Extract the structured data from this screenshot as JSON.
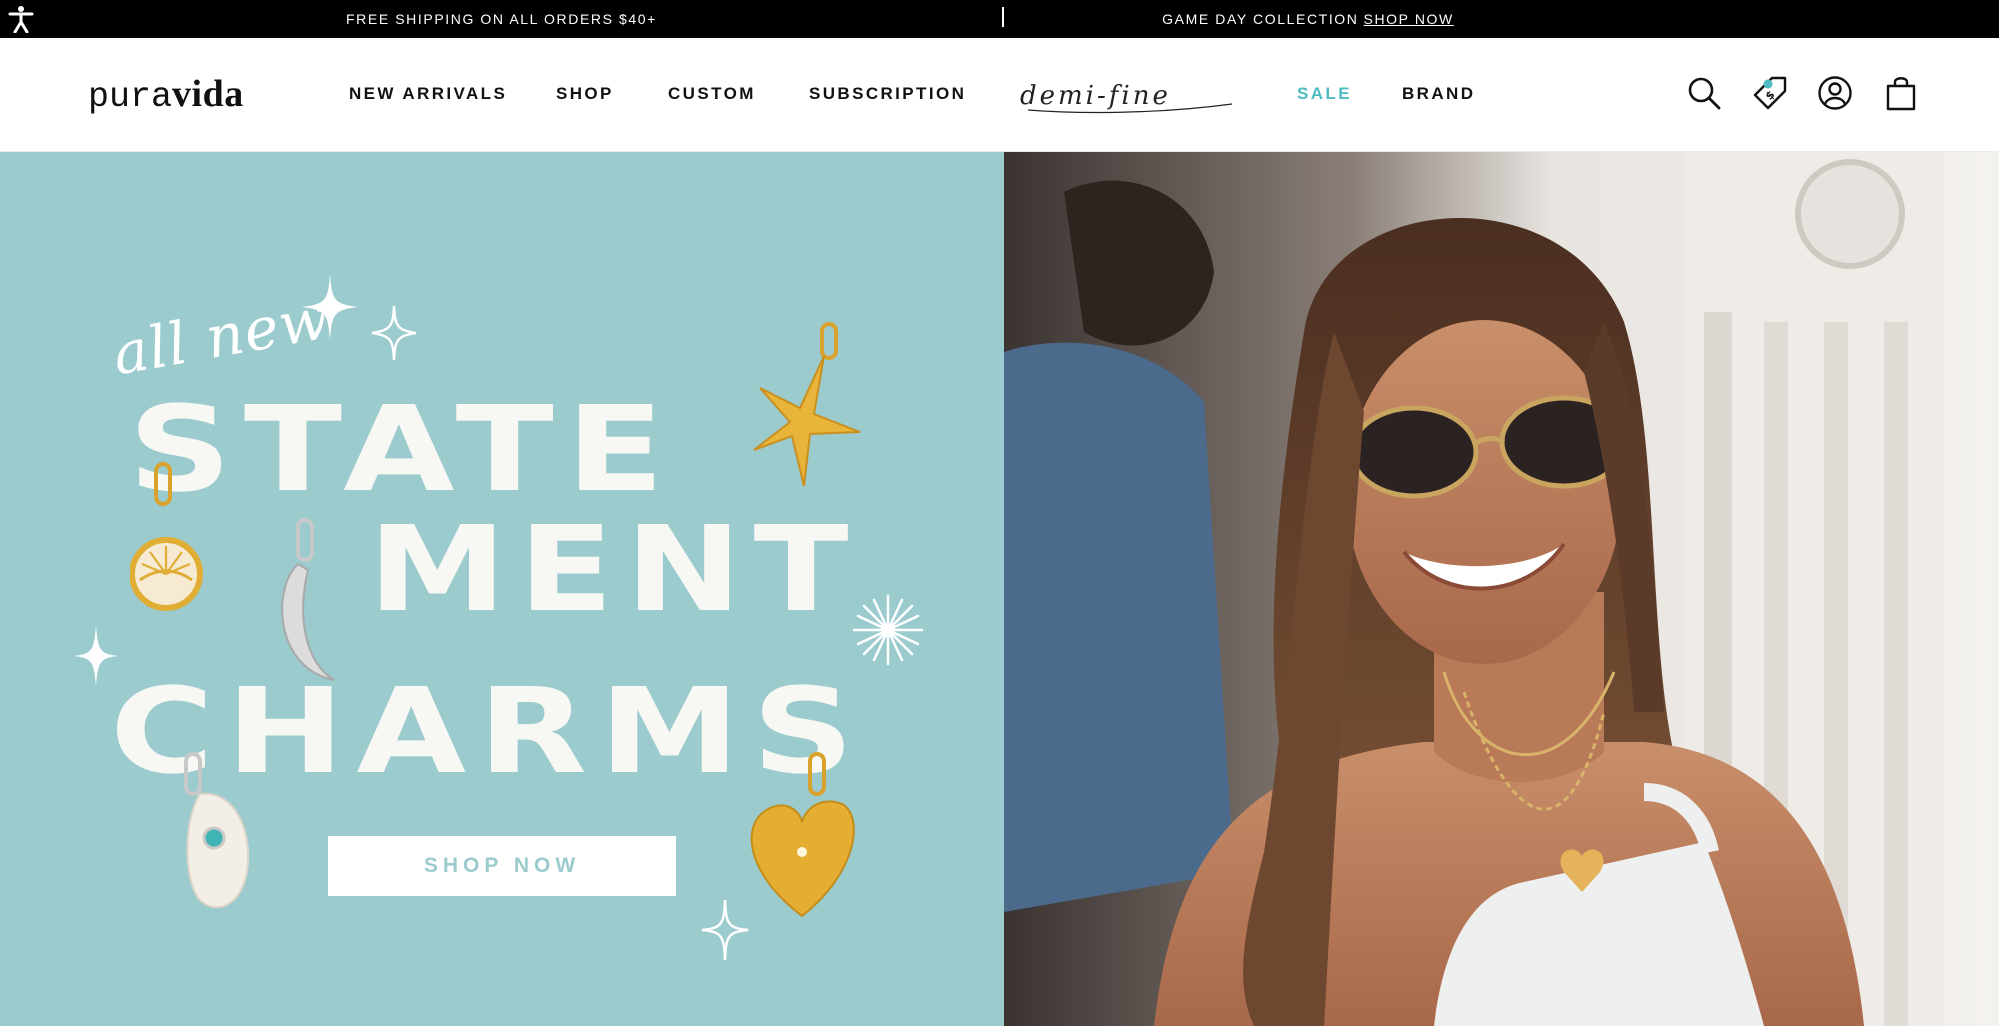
{
  "announcement": {
    "left_text": "FREE SHIPPING ON ALL ORDERS $40+",
    "right_text": "GAME DAY COLLECTION",
    "right_link": "SHOP NOW"
  },
  "header": {
    "logo_part1": "pura",
    "logo_part2": "vida",
    "nav": [
      {
        "label": "NEW ARRIVALS"
      },
      {
        "label": "SHOP"
      },
      {
        "label": "CUSTOM"
      },
      {
        "label": "SUBSCRIPTION"
      },
      {
        "label": "demi-fine"
      },
      {
        "label": "SALE"
      },
      {
        "label": "BRAND"
      }
    ],
    "icons": [
      "search-icon",
      "rewards-tag-icon",
      "account-icon",
      "cart-bag-icon"
    ]
  },
  "hero": {
    "script_text": "all new",
    "line1": "STATE",
    "line2": "MENT",
    "line3": "CHARMS",
    "cta": "SHOP NOW"
  },
  "colors": {
    "hero_bg": "#9ccbce",
    "sale": "#4fbcc3",
    "gold": "#e0ad35"
  }
}
